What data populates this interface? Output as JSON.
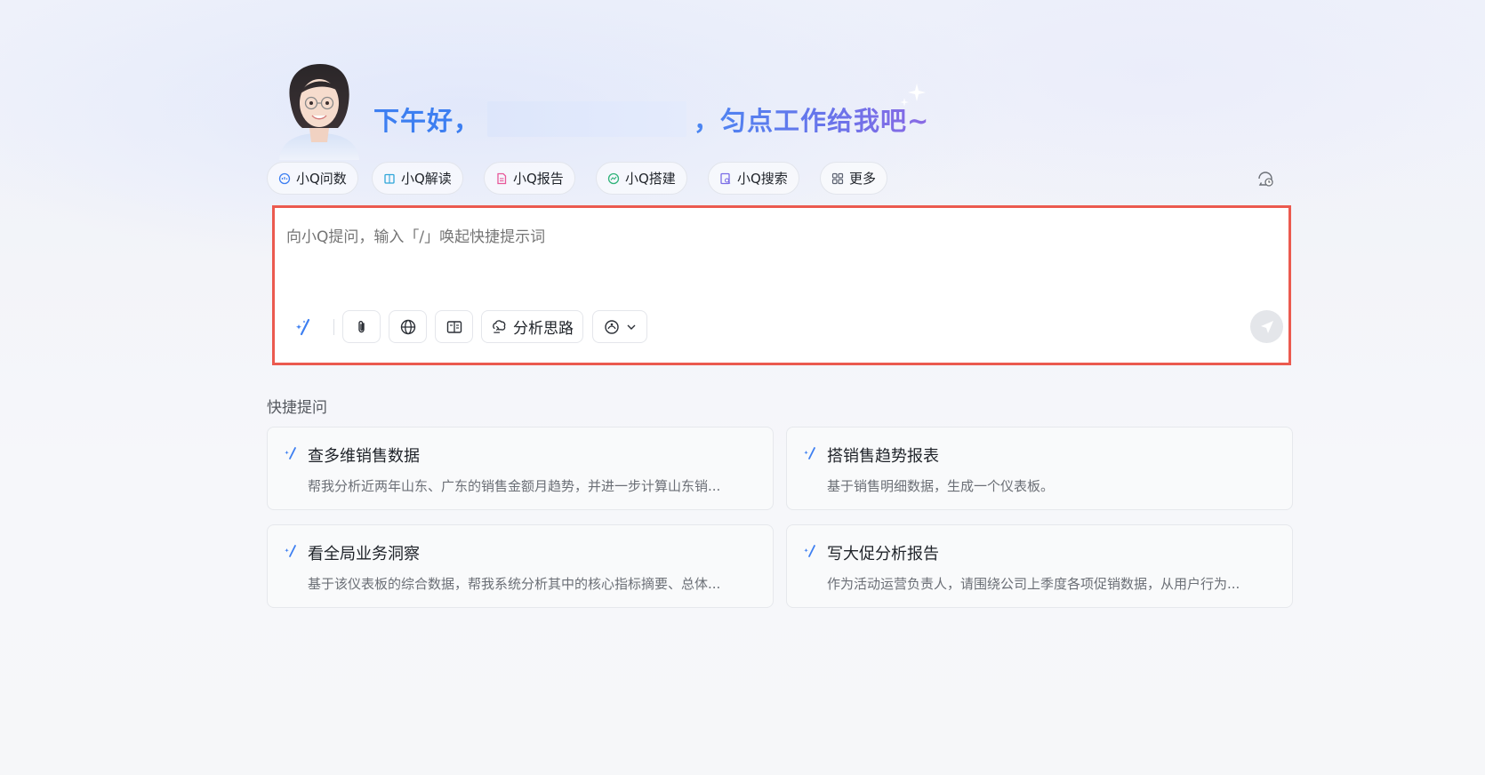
{
  "greeting": {
    "prefix": "下午好，",
    "suffix": "，匀点工作给我吧~"
  },
  "modes": [
    {
      "label": "小Q问数",
      "icon": "chat-data-icon",
      "color": "#3d7ff1"
    },
    {
      "label": "小Q解读",
      "icon": "book-icon",
      "color": "#2fa6d9"
    },
    {
      "label": "小Q报告",
      "icon": "report-icon",
      "color": "#e8589a"
    },
    {
      "label": "小Q搭建",
      "icon": "build-icon",
      "color": "#2fb37a"
    },
    {
      "label": "小Q搜索",
      "icon": "search-doc-icon",
      "color": "#7a6de6"
    },
    {
      "label": "更多",
      "icon": "grid-icon",
      "color": "#5b6170"
    }
  ],
  "input": {
    "placeholder": "向小Q提问，输入「/」唤起快捷提示词"
  },
  "toolbar": {
    "analysis_label": "分析思路"
  },
  "quick": {
    "title": "快捷提问",
    "cards": [
      {
        "title": "查多维销售数据",
        "desc": "帮我分析近两年山东、广东的销售金额月趋势，并进一步计算山东销..."
      },
      {
        "title": "搭销售趋势报表",
        "desc": "基于销售明细数据，生成一个仪表板。"
      },
      {
        "title": "看全局业务洞察",
        "desc": "基于该仪表板的综合数据，帮我系统分析其中的核心指标摘要、总体..."
      },
      {
        "title": "写大促分析报告",
        "desc": "作为活动运营负责人，请围绕公司上季度各项促销数据，从用户行为..."
      }
    ]
  },
  "colors": {
    "accent": "#3d7ff1",
    "highlight_border": "#eb5a4f"
  }
}
